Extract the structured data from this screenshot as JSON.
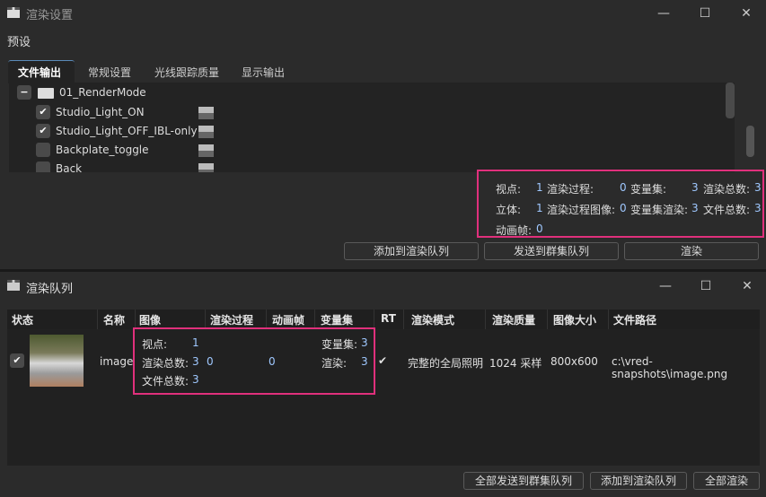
{
  "settings_window": {
    "title": "渲染设置",
    "preset_label": "预设",
    "tabs": [
      "文件输出",
      "常规设置",
      "光线跟踪质量",
      "显示输出"
    ],
    "tree": {
      "folder": "01_RenderMode",
      "items": [
        {
          "label": "Studio_Light_ON",
          "checked": true
        },
        {
          "label": "Studio_Light_OFF_IBL-only",
          "checked": true
        },
        {
          "label": "Backplate_toggle",
          "checked": false
        },
        {
          "label": "Back",
          "checked": false
        }
      ]
    },
    "stats": {
      "viewpoint_label": "视点:",
      "viewpoint": "1",
      "render_pass_label": "渲染过程:",
      "render_pass": "0",
      "variant_set_label": "变量集:",
      "variant_set": "3",
      "render_total_label": "渲染总数:",
      "render_total": "3",
      "stereo_label": "立体:",
      "stereo": "1",
      "render_pass_image_label": "渲染过程图像:",
      "render_pass_image": "0",
      "variant_render_label": "变量集渲染:",
      "variant_render": "3",
      "file_total_label": "文件总数:",
      "file_total": "3",
      "anim_frame_label": "动画帧:",
      "anim_frame": "0"
    },
    "buttons": {
      "add_queue": "添加到渲染队列",
      "send_cluster": "发送到群集队列",
      "render": "渲染"
    }
  },
  "queue_window": {
    "title": "渲染队列",
    "columns": [
      "状态",
      "名称",
      "图像",
      "渲染过程",
      "动画帧",
      "变量集",
      "RT",
      "渲染模式",
      "渲染质量",
      "图像大小",
      "文件路径"
    ],
    "row": {
      "checked": true,
      "name": "image",
      "viewpoint_label": "视点:",
      "viewpoint": "1",
      "render_total_label": "渲染总数:",
      "render_total": "3",
      "file_total_label": "文件总数:",
      "file_total": "3",
      "render_pass": "0",
      "anim_frame": "0",
      "variant_set_label": "变量集:",
      "variant_set": "3",
      "render_label": "渲染:",
      "render": "3",
      "rt": "✔",
      "render_mode": "完整的全局照明",
      "quality": "1024 采样",
      "size": "800x600",
      "path": "c:\\vred-snapshots\\image.png"
    },
    "buttons": {
      "send_all": "全部发送到群集队列",
      "add_queue": "添加到渲染队列",
      "render_all": "全部渲染"
    }
  },
  "colors": {
    "highlight": "#e0307c",
    "value": "#9fc8ff"
  }
}
